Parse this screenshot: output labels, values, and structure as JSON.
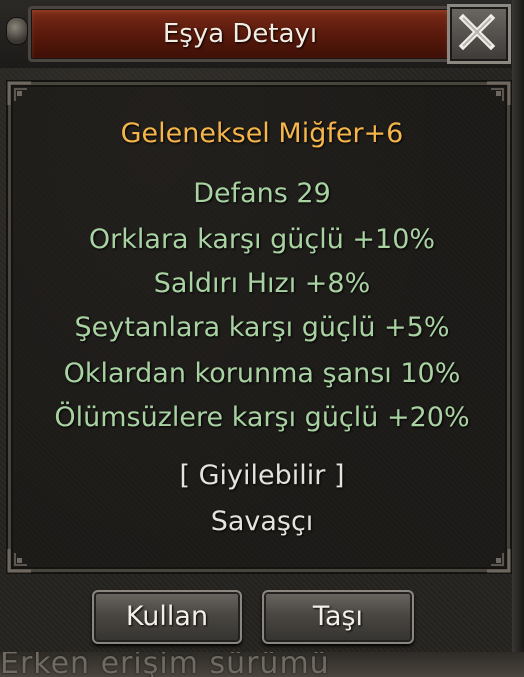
{
  "window": {
    "title": "Eşya Detayı",
    "close_icon": "close-x-icon"
  },
  "item": {
    "name": "Geleneksel Miğfer+6",
    "name_color": "#f5b54a",
    "stats": [
      "Defans 29",
      "Orklara karşı güçlü +10%",
      "Saldırı Hızı +8%",
      "Şeytanlara karşı güçlü +5%",
      "Oklardan korunma şansı 10%",
      "Ölümsüzlere karşı güçlü +20%"
    ],
    "stat_color": "#a9d2a2",
    "wearable": "[ Giyilebilir ]",
    "class": "Savaşçı"
  },
  "buttons": {
    "use_label": "Kullan",
    "move_label": "Taşı"
  },
  "background": {
    "bottom_text": "Erken erişim sürümü"
  }
}
